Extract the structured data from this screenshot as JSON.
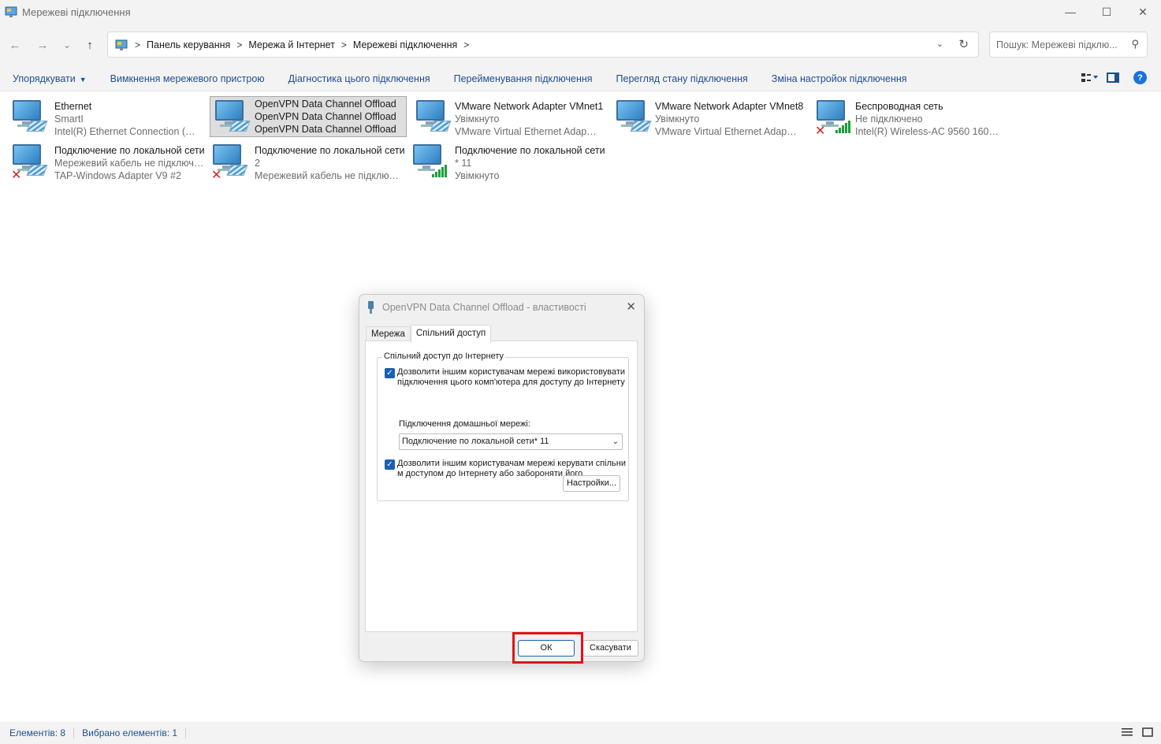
{
  "window": {
    "title": "Мережеві підключення",
    "minimize_glyph": "—",
    "maximize_glyph": "☐",
    "close_glyph": "✕"
  },
  "nav": {
    "back_glyph": "←",
    "forward_glyph": "→",
    "recent_glyph": "⌄",
    "up_glyph": "↑"
  },
  "breadcrumbs": [
    "Панель керування",
    "Мережа й Інтернет",
    "Мережеві підключення"
  ],
  "search": {
    "placeholder": "Пошук: Мережеві підклю..."
  },
  "toolbar": {
    "organize": "Упорядкувати",
    "items": [
      "Вимкнення мережевого пристрою",
      "Діагностика цього підключення",
      "Перейменування підключення",
      "Перегляд стану підключення",
      "Зміна настройок підключення"
    ],
    "help_glyph": "?"
  },
  "connections": [
    {
      "name": "Ethernet",
      "status": "SmartI",
      "device": "Intel(R) Ethernet Connection (7) I...",
      "kind": "wired",
      "error": false,
      "selected": false
    },
    {
      "name": "OpenVPN Data Channel Offload",
      "status": "OpenVPN Data Channel Offload",
      "device": "OpenVPN Data Channel Offload",
      "kind": "wired",
      "error": false,
      "selected": true
    },
    {
      "name": "VMware Network Adapter VMnet1",
      "status": "Увімкнуто",
      "device": "VMware Virtual Ethernet Adapter ...",
      "kind": "wired",
      "error": false,
      "selected": false
    },
    {
      "name": "VMware Network Adapter VMnet8",
      "status": "Увімкнуто",
      "device": "VMware Virtual Ethernet Adapter ...",
      "kind": "wired",
      "error": false,
      "selected": false
    },
    {
      "name": "Беспроводная сеть",
      "status": "Не підключено",
      "device": "Intel(R) Wireless-AC 9560 160MHz",
      "kind": "wireless",
      "error": true,
      "selected": false
    },
    {
      "name": "Подключение по локальной сети",
      "status": "Мережевий кабель не підключе...",
      "device": "TAP-Windows Adapter V9 #2",
      "kind": "wired",
      "error": true,
      "selected": false
    },
    {
      "name": "Подключение по локальной сети",
      "status": "2",
      "device": "Мережевий кабель не підключе...",
      "kind": "wired",
      "error": true,
      "selected": false
    },
    {
      "name": "Подключение по локальной сети",
      "status": "* 11",
      "device": "Увімкнуто",
      "kind": "wireless",
      "error": false,
      "selected": false
    }
  ],
  "dialog": {
    "title": "OpenVPN Data Channel Offload - властивості",
    "close_glyph": "✕",
    "tabs": [
      "Мережа",
      "Спільний доступ"
    ],
    "group_title": "Спільний доступ до Інтернету",
    "checkbox1": "Дозволити іншим користувачам мережі використовувати підключення цього комп'ютера для доступу до Інтернету",
    "home_network_label": "Підключення домашньої мережі:",
    "home_network_value": "Подключение по локальной сети* 11",
    "checkbox2": "Дозволити іншим користувачам мережі керувати спільним доступом до Інтернету або забороняти його",
    "settings_button": "Настройки...",
    "ok_button": "ОК",
    "cancel_button": "Скасувати",
    "check_glyph": "✓"
  },
  "statusbar": {
    "items_count": "Елементів: 8",
    "selected_count": "Вибрано елементів: 1"
  },
  "colors": {
    "accent": "#1f4e91",
    "highlight": "#e0131a",
    "checkbox": "#1a5fb4"
  }
}
